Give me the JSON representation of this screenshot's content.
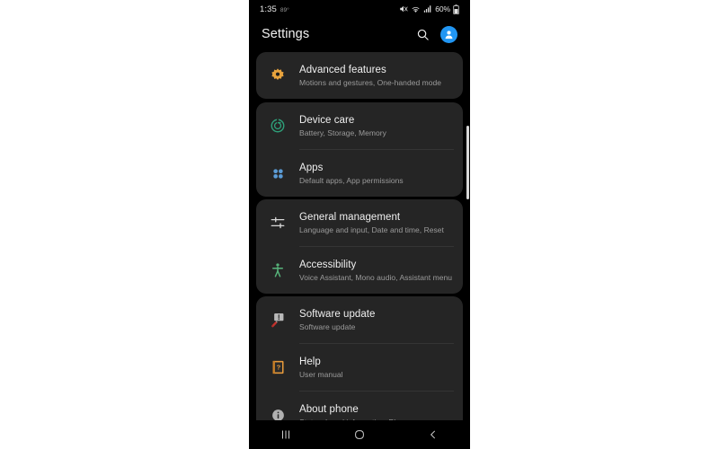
{
  "status_bar": {
    "time": "1:35",
    "temperature": "89°",
    "battery_percent": "60%",
    "icons": [
      "mute-icon",
      "wifi-icon",
      "signal-icon",
      "battery-icon"
    ]
  },
  "app_bar": {
    "title": "Settings",
    "search_icon": "search-icon",
    "avatar_icon": "account-avatar-icon"
  },
  "colors": {
    "screen_background": "#000000",
    "card_background": "#252525",
    "title_text": "#f0f0f0",
    "subtitle_text": "#9b9b9b",
    "accent_avatar": "#2196f3",
    "gear_amber": "#e8a33d",
    "device_care_green": "#2e9e78",
    "apps_blue": "#5b9bd5",
    "accessibility_green": "#57b37a",
    "help_orange": "#e79a3c",
    "about_gray": "#b0b0b0"
  },
  "cards": [
    {
      "id": "card-advanced",
      "rows": [
        {
          "name": "advanced-features",
          "icon": "gear-icon",
          "title": "Advanced features",
          "subtitle": "Motions and gestures, One-handed mode"
        }
      ]
    },
    {
      "id": "card-device",
      "rows": [
        {
          "name": "device-care",
          "icon": "device-care-icon",
          "title": "Device care",
          "subtitle": "Battery, Storage, Memory"
        },
        {
          "name": "apps",
          "icon": "apps-grid-icon",
          "title": "Apps",
          "subtitle": "Default apps, App permissions"
        }
      ]
    },
    {
      "id": "card-general",
      "rows": [
        {
          "name": "general-management",
          "icon": "sliders-icon",
          "title": "General management",
          "subtitle": "Language and input, Date and time, Reset"
        },
        {
          "name": "accessibility",
          "icon": "accessibility-icon",
          "title": "Accessibility",
          "subtitle": "Voice Assistant, Mono audio, Assistant menu"
        }
      ]
    },
    {
      "id": "card-support",
      "rows": [
        {
          "name": "software-update",
          "icon": "software-update-icon",
          "title": "Software update",
          "subtitle": "Software update"
        },
        {
          "name": "help",
          "icon": "help-book-icon",
          "title": "Help",
          "subtitle": "User manual"
        },
        {
          "name": "about-phone",
          "icon": "info-icon",
          "title": "About phone",
          "subtitle": "Status, Legal information, Phone name"
        }
      ]
    }
  ],
  "nav_bar": {
    "recents_label": "recents-icon",
    "home_label": "home-icon",
    "back_label": "back-icon"
  }
}
